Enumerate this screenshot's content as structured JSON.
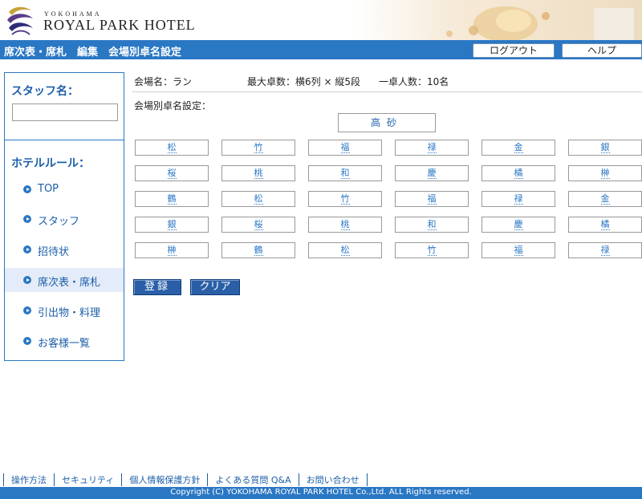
{
  "header": {
    "logo_small": "YOKOHAMA",
    "logo_big": "ROYAL PARK HOTEL"
  },
  "titlebar": {
    "title": "席次表・席札　編集　会場別卓名設定",
    "logout_label": "ログアウト",
    "help_label": "ヘルプ"
  },
  "sidebar": {
    "staff_label": "スタッフ名：",
    "staff_value": "",
    "rule_label": "ホテルルール：",
    "items": [
      {
        "label": "TOP",
        "active": false
      },
      {
        "label": "スタッフ",
        "active": false
      },
      {
        "label": "招待状",
        "active": false
      },
      {
        "label": "席次表・席札",
        "active": true
      },
      {
        "label": "引出物・料理",
        "active": false
      },
      {
        "label": "お客様一覧",
        "active": false
      }
    ]
  },
  "main": {
    "venue": "会場名：ラン",
    "max_tables": "最大卓数：横6列 × 縦5段",
    "per_table": "一卓人数：10名",
    "setting_label": "会場別卓名設定：",
    "head_table": "高砂",
    "tables": [
      [
        "松",
        "竹",
        "福",
        "禄",
        "金",
        "銀"
      ],
      [
        "桜",
        "桃",
        "和",
        "慶",
        "橘",
        "榊"
      ],
      [
        "鶴",
        "松",
        "竹",
        "福",
        "禄",
        "金"
      ],
      [
        "銀",
        "桜",
        "桃",
        "和",
        "慶",
        "橘"
      ],
      [
        "榊",
        "鶴",
        "松",
        "竹",
        "福",
        "禄"
      ]
    ],
    "register_label": "登録",
    "clear_label": "クリア"
  },
  "footer": {
    "links": [
      "操作方法",
      "セキュリティ",
      "個人情報保護方針",
      "よくある質問 Q&A",
      "お問い合わせ"
    ],
    "copyright": "Copyright (C) YOKOHAMA ROYAL PARK HOTEL Co.,Ltd. ALL Rights reserved."
  },
  "colors": {
    "accent": "#2a77c4",
    "link": "#1c5fa8",
    "button": "#2a5fa8"
  }
}
